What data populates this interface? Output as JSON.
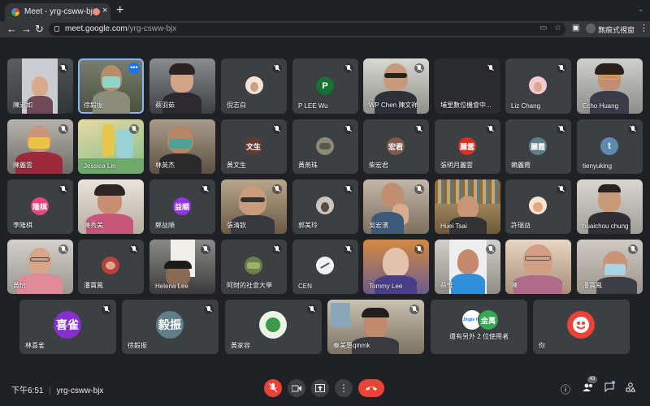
{
  "browser": {
    "tab_title": "Meet - yrg-csww-bjx",
    "tab_close": "×",
    "new_tab": "+",
    "back": "←",
    "forward": "→",
    "reload": "↻",
    "url_host": "meet.google.com",
    "url_path": "/yrg-csww-bjx",
    "incognito_label": "無痕式視窗",
    "menu": "⋮"
  },
  "participants_row1": [
    "陳淑如",
    "徐毅振",
    "蔡羽茹",
    "倪志白",
    "P LEE Wu",
    "WP Chen 陳文祥",
    "埔里數位機會中...",
    "Liz Chang",
    "Echo Huang"
  ],
  "participants_row2": [
    "陳麗雲",
    "Jessica Lin",
    "林英杰",
    "黃文生",
    "黃燕珠",
    "柴宏君",
    "張明月麗雲",
    "賴麗霞",
    "tienyuking"
  ],
  "participants_row3": [
    "李隆棋",
    "陳秀美",
    "鄭益順",
    "張清欽",
    "郭美玲",
    "吳宏濱",
    "Huei Tsai",
    "許瑞益",
    "huaichou chung"
  ],
  "participants_row4": [
    "黃怡",
    "潘寶鳳",
    "Helena Lee",
    "阿財的社會大學",
    "CEN",
    "Tommy Lee",
    "蔡惟",
    "陳",
    "潘寶鳳"
  ],
  "participants_row5": [
    "林喜雀",
    "徐毅振",
    "黃家容",
    "秦美惠qinmk",
    "還有另外 2 位使用者",
    "你"
  ],
  "avatars": {
    "p_lee_wu": "P",
    "huang_wensheng": "文生",
    "chai_hongjun": "宏君",
    "zhang_mingyue": "麗雲",
    "lai_lixia": "麗霞",
    "tienyuking": "t",
    "li_longqi": "隆棋",
    "zheng_yishun": "益順",
    "lin_xique": "喜雀",
    "xu_yizhen": "毅振",
    "others_1": "Jingle Ho",
    "others_2": "金萬"
  },
  "colors": {
    "p_lee_wu": "#137333",
    "huang_wensheng": "#5f3b32",
    "chai_hongjun": "#7d5a4b",
    "zhang_mingyue": "#d93025",
    "lai_lixia": "#5f7e8a",
    "tienyuking": "#5f8ab0",
    "li_longqi": "#e8457b",
    "zheng_yishun": "#9334e6",
    "lin_xique": "#8430ce",
    "xu_yizhen": "#5f7e8a",
    "others_1": "#ffffff",
    "others_2": "#34a853",
    "you": "#ea4335",
    "speaking": "#8ab4f8",
    "hangup": "#ea4335"
  },
  "bottom_bar": {
    "time_label": "下午6:51",
    "separator": "|",
    "meeting_code": "yrg-csww-bjx",
    "participants_count": "43"
  }
}
